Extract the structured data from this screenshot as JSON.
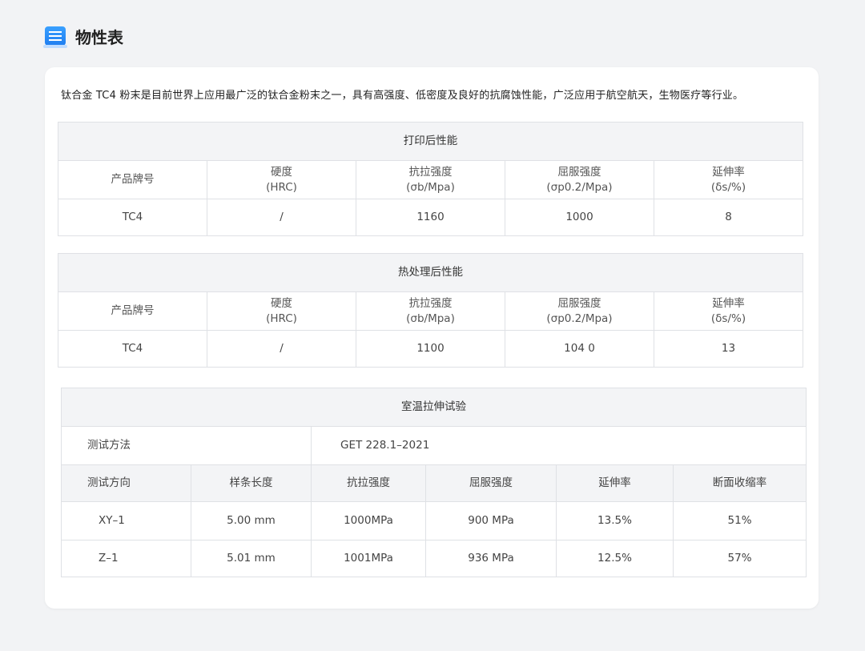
{
  "header": {
    "title": "物性表",
    "icon": "table-icon"
  },
  "intro": "钛合金 TC4 粉末是目前世界上应用最广泛的钛合金粉末之一，具有高强度、低密度及良好的抗腐蚀性能，广泛应用于航空航天，生物医疗等行业。",
  "table_after_print": {
    "caption": "打印后性能",
    "headers": [
      {
        "l1": "产品牌号",
        "l2": ""
      },
      {
        "l1": "硬度",
        "l2": "(HRC)"
      },
      {
        "l1": "抗拉强度",
        "l2": "(σb/Mpa)"
      },
      {
        "l1": "屈服强度",
        "l2": "(σp0.2/Mpa)"
      },
      {
        "l1": "延伸率",
        "l2": "(δs/%)"
      }
    ],
    "row": [
      "TC4",
      "/",
      "1160",
      "1000",
      "8"
    ]
  },
  "table_heat_treated": {
    "caption": "热处理后性能",
    "headers": [
      {
        "l1": "产品牌号",
        "l2": ""
      },
      {
        "l1": "硬度",
        "l2": "(HRC)"
      },
      {
        "l1": "抗拉强度",
        "l2": "(σb/Mpa)"
      },
      {
        "l1": "屈服强度",
        "l2": "(σp0.2/Mpa)"
      },
      {
        "l1": "延伸率",
        "l2": "(δs/%)"
      }
    ],
    "row": [
      "TC4",
      "/",
      "1100",
      "104 0",
      "13"
    ]
  },
  "table_tensile": {
    "caption": "室温拉伸试验",
    "method_label": "测试方法",
    "method_value": "GET 228.1–2021",
    "headers": [
      "测试方向",
      "样条长度",
      "抗拉强度",
      "屈服强度",
      "延伸率",
      "断面收缩率"
    ],
    "rows": [
      [
        "XY–1",
        "5.00 mm",
        "1000MPa",
        "900 MPa",
        "13.5%",
        "51%"
      ],
      [
        "Z–1",
        "5.01 mm",
        "1001MPa",
        "936 MPa",
        "12.5%",
        "57%"
      ]
    ]
  }
}
